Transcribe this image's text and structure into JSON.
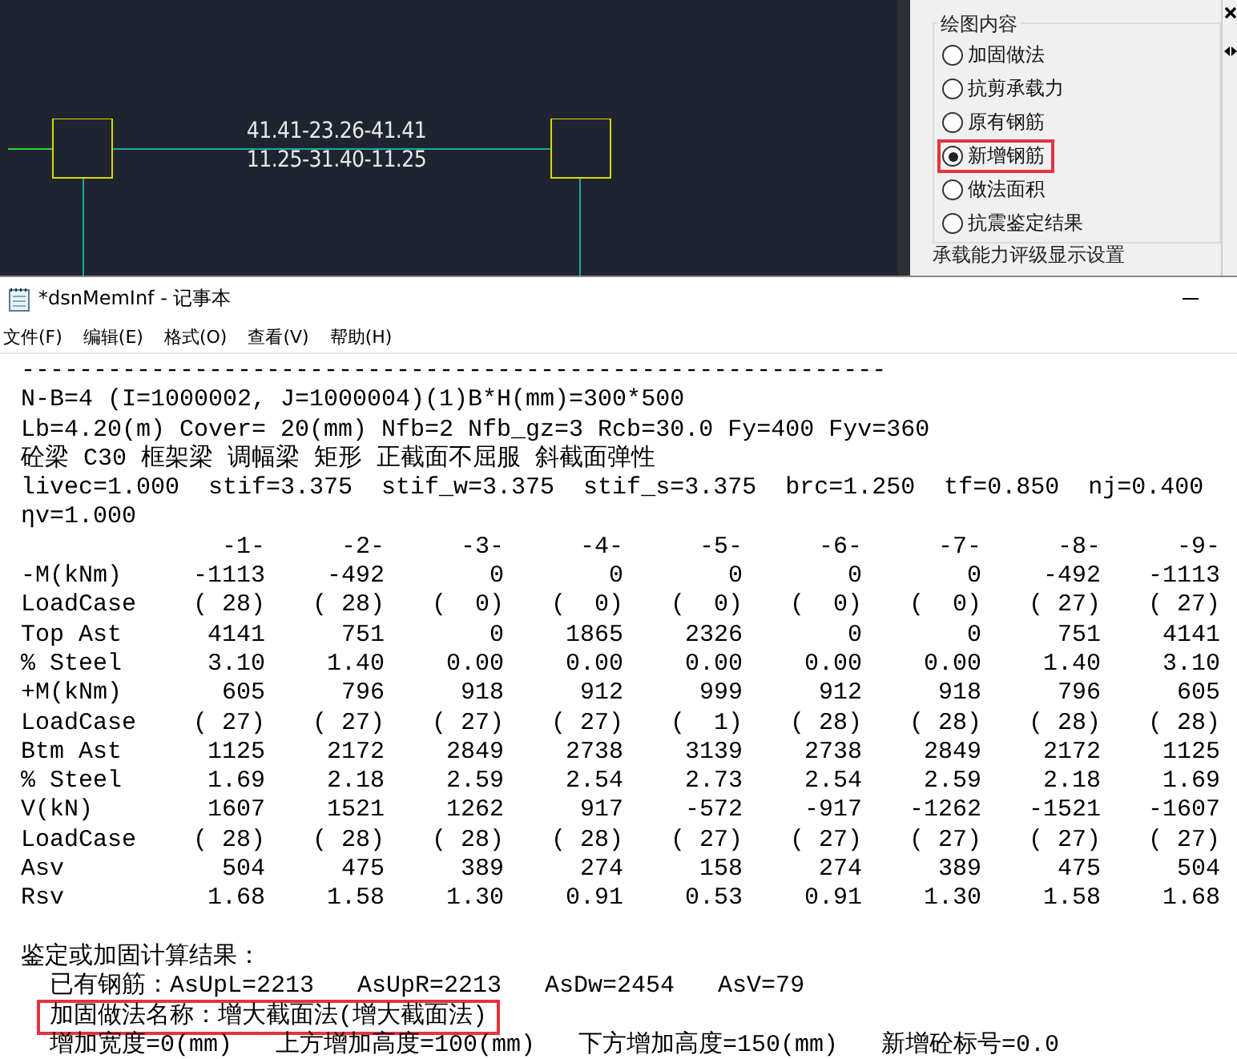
{
  "cad": {
    "labels": [
      "41.41-23.26-41.41",
      "11.25-31.40-11.25"
    ]
  },
  "panel": {
    "group_title": "绘图内容",
    "options": [
      {
        "label": "加固做法",
        "selected": false,
        "highlighted": false
      },
      {
        "label": "抗剪承载力",
        "selected": false,
        "highlighted": false
      },
      {
        "label": "原有钢筋",
        "selected": false,
        "highlighted": false
      },
      {
        "label": "新增钢筋",
        "selected": true,
        "highlighted": true
      },
      {
        "label": "做法面积",
        "selected": false,
        "highlighted": false
      },
      {
        "label": "抗震鉴定结果",
        "selected": false,
        "highlighted": false
      }
    ],
    "next_group_title": "承载能力评级显示设置"
  },
  "notepad": {
    "title": "*dsnMemInf - 记事本",
    "menu": [
      "文件(F)",
      "编辑(E)",
      "格式(O)",
      "查看(V)",
      "帮助(H)"
    ],
    "header_lines": [
      "------------------------------------------------------------",
      "N-B=4 (I=1000002, J=1000004)(1)B*H(mm)=300*500",
      "Lb=4.20(m) Cover= 20(mm) Nfb=2 Nfb_gz=3 Rcb=30.0 Fy=400 Fyv=360",
      "砼梁 C30 框架梁 调幅梁 矩形 正截面不屈服 斜截面弹性",
      "livec=1.000  stif=3.375  stif_w=3.375  stif_s=3.375  brc=1.250  tf=0.850  nj=0.400",
      "ηv=1.000"
    ],
    "table": {
      "columns": [
        "-1-",
        "-2-",
        "-3-",
        "-4-",
        "-5-",
        "-6-",
        "-7-",
        "-8-",
        "-9-"
      ],
      "rows": [
        {
          "label": "-M(kNm)",
          "values": [
            "-1113",
            "-492",
            "0",
            "0",
            "0",
            "0",
            "0",
            "-492",
            "-1113"
          ]
        },
        {
          "label": "LoadCase",
          "values": [
            "( 28)",
            "( 28)",
            "(  0)",
            "(  0)",
            "(  0)",
            "(  0)",
            "(  0)",
            "( 27)",
            "( 27)"
          ]
        },
        {
          "label": "Top Ast",
          "values": [
            "4141",
            "751",
            "0",
            "1865",
            "2326",
            "0",
            "0",
            "751",
            "4141"
          ]
        },
        {
          "label": "% Steel",
          "values": [
            "3.10",
            "1.40",
            "0.00",
            "0.00",
            "0.00",
            "0.00",
            "0.00",
            "1.40",
            "3.10"
          ]
        },
        {
          "label": "+M(kNm)",
          "values": [
            "605",
            "796",
            "918",
            "912",
            "999",
            "912",
            "918",
            "796",
            "605"
          ]
        },
        {
          "label": "LoadCase",
          "values": [
            "( 27)",
            "( 27)",
            "( 27)",
            "( 27)",
            "(  1)",
            "( 28)",
            "( 28)",
            "( 28)",
            "( 28)"
          ]
        },
        {
          "label": "Btm Ast",
          "values": [
            "1125",
            "2172",
            "2849",
            "2738",
            "3139",
            "2738",
            "2849",
            "2172",
            "1125"
          ]
        },
        {
          "label": "% Steel",
          "values": [
            "1.69",
            "2.18",
            "2.59",
            "2.54",
            "2.73",
            "2.54",
            "2.59",
            "2.18",
            "1.69"
          ]
        },
        {
          "label": "V(kN)",
          "values": [
            "1607",
            "1521",
            "1262",
            "917",
            "-572",
            "-917",
            "-1262",
            "-1521",
            "-1607"
          ]
        },
        {
          "label": "LoadCase",
          "values": [
            "( 28)",
            "( 28)",
            "( 28)",
            "( 28)",
            "( 27)",
            "( 27)",
            "( 27)",
            "( 27)",
            "( 27)"
          ]
        },
        {
          "label": "Asv",
          "values": [
            "504",
            "475",
            "389",
            "274",
            "158",
            "274",
            "389",
            "475",
            "504"
          ]
        },
        {
          "label": "Rsv",
          "values": [
            "1.68",
            "1.58",
            "1.30",
            "0.91",
            "0.53",
            "0.91",
            "1.30",
            "1.58",
            "1.68"
          ]
        }
      ]
    },
    "results": {
      "title": "鉴定或加固计算结果：",
      "lines": [
        {
          "text": "已有钢筋：AsUpL=2213   AsUpR=2213   AsDw=2454   AsV=79",
          "highlighted": false
        },
        {
          "text": "加固做法名称：增大截面法(增大截面法)",
          "highlighted": true
        },
        {
          "text": "增加宽度=0(mm)   上方增加高度=100(mm)   下方增加高度=150(mm)   新增砼标号=0.0",
          "highlighted": false
        }
      ]
    }
  }
}
